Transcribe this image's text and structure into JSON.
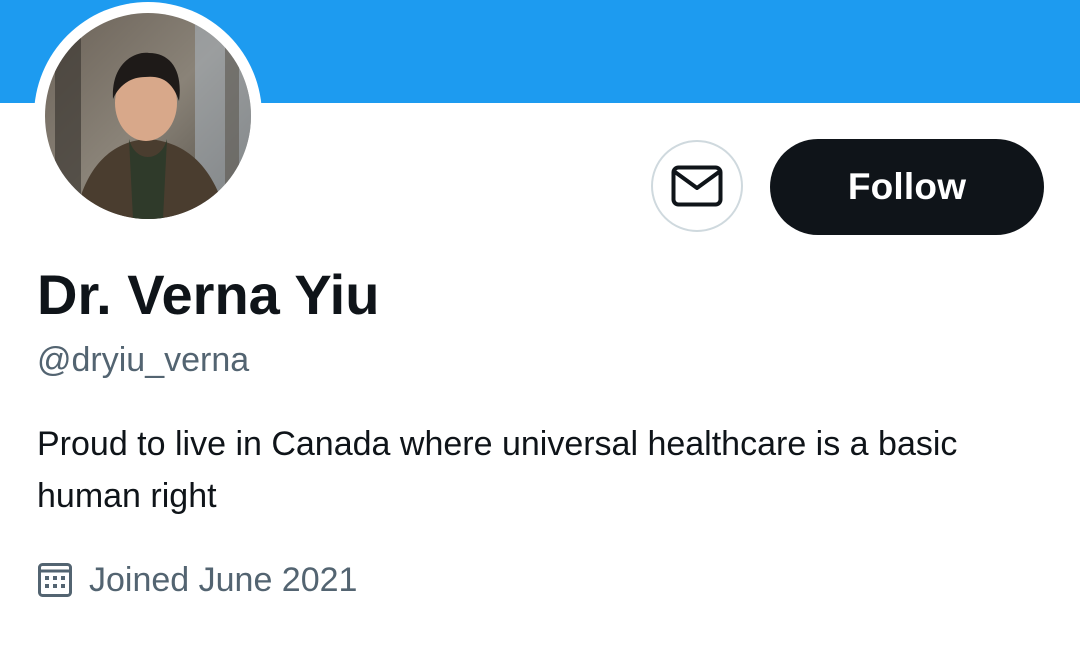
{
  "colors": {
    "banner": "#1d9bf0",
    "follow_bg": "#0f1419",
    "secondary_text": "#536471"
  },
  "profile": {
    "display_name": "Dr. Verna Yiu",
    "handle": "@dryiu_verna",
    "bio": "Proud to live in Canada where universal healthcare is a basic human right",
    "joined": "Joined June 2021"
  },
  "actions": {
    "message_icon": "envelope-icon",
    "follow_label": "Follow"
  },
  "icons": {
    "joined": "calendar-icon"
  }
}
